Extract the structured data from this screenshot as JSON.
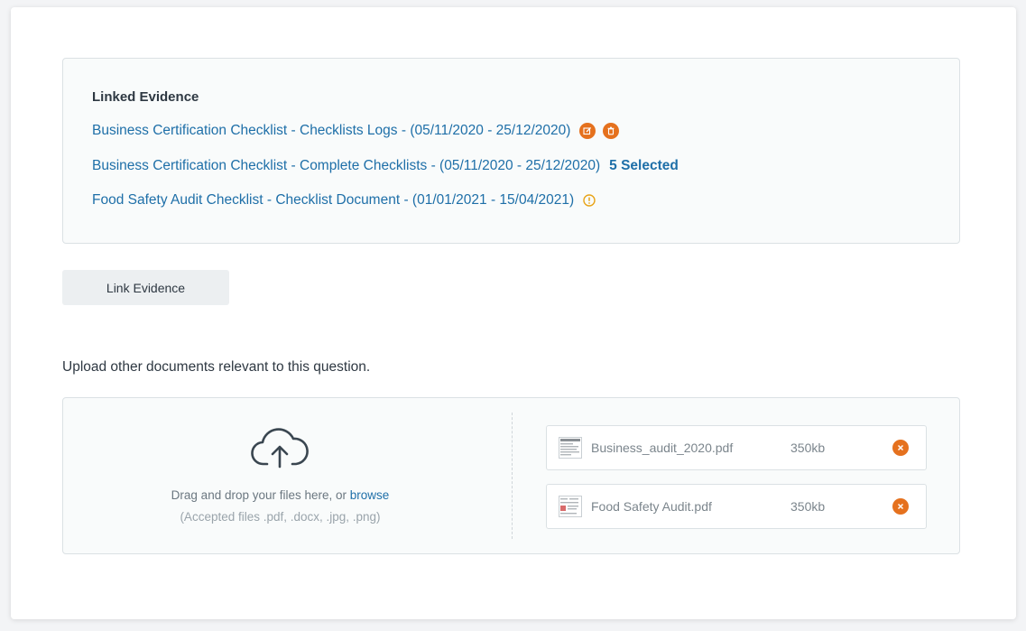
{
  "linked_evidence": {
    "title": "Linked Evidence",
    "items": [
      {
        "label": "Business Certification Checklist - Checklists Logs - (05/11/2020 - 25/12/2020)",
        "actions": [
          "edit-icon",
          "delete-icon"
        ]
      },
      {
        "label": "Business Certification Checklist - Complete Checklists - (05/11/2020 - 25/12/2020)",
        "badge": "5 Selected"
      },
      {
        "label": "Food Safety Audit Checklist -  Checklist Document - (01/01/2021 - 15/04/2021)",
        "status_icon": "warning-icon"
      }
    ]
  },
  "link_button": "Link Evidence",
  "upload": {
    "label": "Upload other documents relevant to this question.",
    "drop_text": "Drag and drop your files here, or",
    "browse_text": "browse",
    "accepted": "(Accepted files .pdf, .docx, .jpg, .png)",
    "icon": "cloud-upload-icon",
    "files": [
      {
        "name": "Business_audit_2020.pdf",
        "size": "350kb"
      },
      {
        "name": "Food Safety Audit.pdf",
        "size": "350kb"
      }
    ]
  },
  "colors": {
    "link": "#1e6fa8",
    "accent": "#e5711e",
    "warning": "#e8a317",
    "text": "#2e3842"
  }
}
